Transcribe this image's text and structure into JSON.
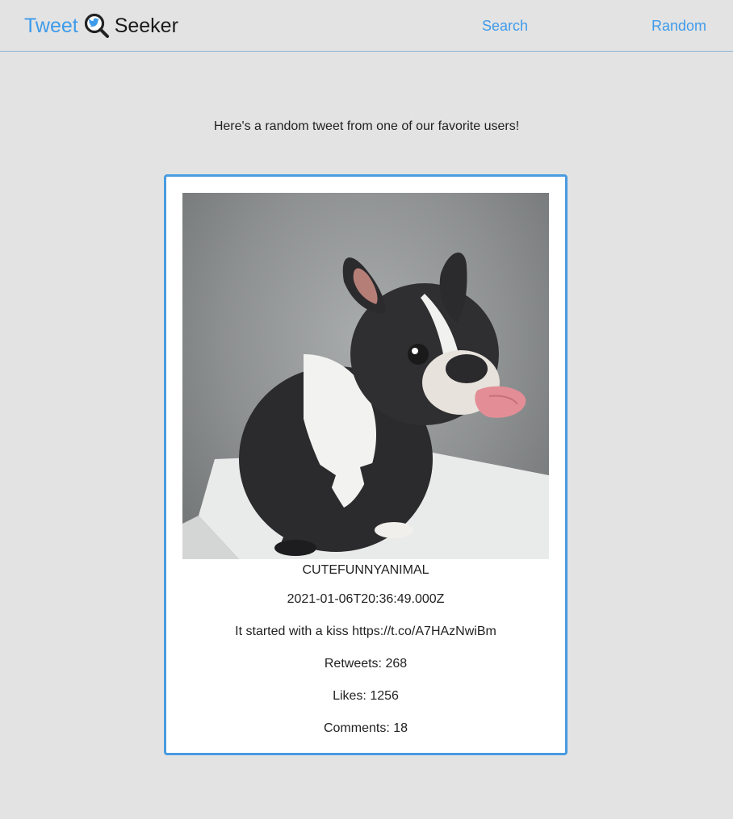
{
  "navbar": {
    "brand_left": "Tweet",
    "brand_right": "Seeker",
    "logo_icon": "magnifier-bird-icon",
    "links": [
      {
        "label": "Search"
      },
      {
        "label": "Random"
      }
    ]
  },
  "intro": "Here's a random tweet from one of our favorite users!",
  "tweet": {
    "image_subject": "french-bulldog-photo",
    "username": "CUTEFUNNYANIMAL",
    "timestamp": "2021-01-06T20:36:49.000Z",
    "text": "It started with a kiss https://t.co/A7HAzNwiBm",
    "retweets": "Retweets: 268",
    "likes": "Likes: 1256",
    "comments": "Comments: 18"
  },
  "colors": {
    "accent": "#3e9bea",
    "background": "#e3e3e3",
    "card_border": "#4a9be0"
  }
}
